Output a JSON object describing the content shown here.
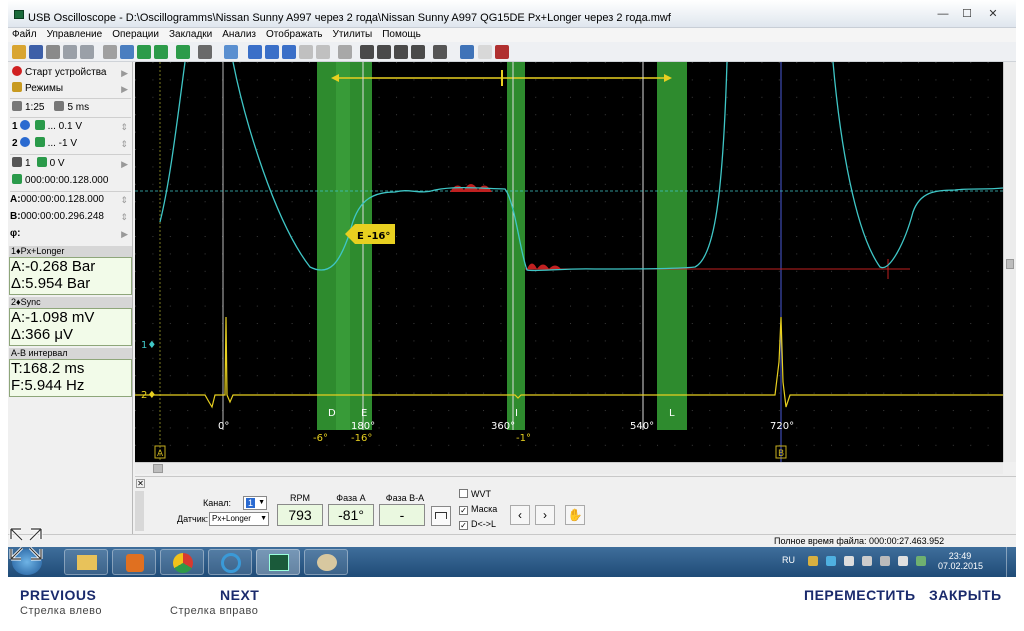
{
  "window": {
    "title": "USB Oscilloscope - D:\\Oscillogramms\\Nissan Sunny A997 через 2 года\\Nissan Sunny A997 QG15DE Px+Longer через 2 года.mwf",
    "minimize": "—",
    "maximize": "☐",
    "close": "✕"
  },
  "menu": [
    "Файл",
    "Управление",
    "Операции",
    "Закладки",
    "Анализ",
    "Отображать",
    "Утилиты",
    "Помощь"
  ],
  "left_panel": {
    "start_device": "Старт устройства",
    "modes": "Режимы",
    "scale_h": "1:25",
    "time_div": "5 ms",
    "ch1_volts": "... 0.1 V",
    "ch2_volts": "... -1 V",
    "trigger_ch": "1",
    "trigger_level": "0 V",
    "trigger_time": "000:00:00.128.000",
    "cursor_a_label": "A:",
    "cursor_a_time": "000:00:00.128.000",
    "cursor_b_label": "B:",
    "cursor_b_time": "000:00:00.296.248",
    "phi_label": "φ:",
    "ch1_head": "1♦Px+Longer",
    "ch1_a": "A:-0.268 Bar",
    "ch1_delta": "Δ:5.954 Bar",
    "ch2_head": "2♦Sync",
    "ch2_a": "A:-1.098 mV",
    "ch2_delta": "Δ:366 μV",
    "ab_head": "A-B интервал",
    "ab_t": "T:168.2 ms",
    "ab_f": "F:5.944 Hz"
  },
  "scope": {
    "trace1_color": "#3fc6c6",
    "trace2_color": "#e8d020",
    "zone_color": "#2e8b2e",
    "ch1_marker": "1♦",
    "ch2_marker": "2♦",
    "cursor_a": "A",
    "cursor_b": "B",
    "zone_letters": [
      "D",
      "E",
      "I",
      "L"
    ],
    "angles": [
      "0°",
      "180°",
      "360°",
      "540°",
      "720°"
    ],
    "phase_labels": [
      "-6°",
      "-16°",
      "-1°"
    ],
    "e_flag": "E -16°"
  },
  "bottom_panel": {
    "channel_label": "Канал:",
    "channel_value": "1",
    "sensor_label": "Датчик:",
    "sensor_value": "Px+Longer",
    "rpm_label": "RPM",
    "rpm_value": "793",
    "phase_a_label": "Фаза A",
    "phase_a_value": "-81°",
    "phase_ba_label": "Фаза B-A",
    "phase_ba_value": "-",
    "wvt_label": "WVT",
    "mask_label": "Маска",
    "dlr_label": "D<->L",
    "prev_btn": "‹",
    "next_btn": "›"
  },
  "status": {
    "total_time": "Полное время файла: 000:00:27.463.952"
  },
  "taskbar": {
    "lang": "RU",
    "time": "23:49",
    "date": "07.02.2015"
  },
  "footer": {
    "previous": "PREVIOUS",
    "previous_hint": "Стрелка влево",
    "next": "NEXT",
    "next_hint": "Стрелка вправо",
    "move": "ПЕРЕМЕСТИТЬ",
    "close": "ЗАКРЫТЬ"
  }
}
